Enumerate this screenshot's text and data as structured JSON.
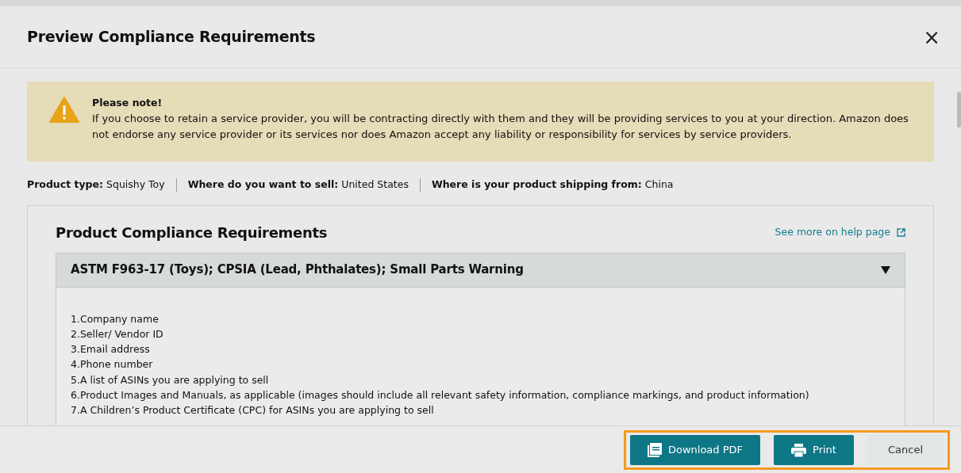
{
  "dialog": {
    "title": "Preview Compliance Requirements",
    "close": "×"
  },
  "notice": {
    "title": "Please note!",
    "text": "If you choose to retain a service provider, you will be contracting directly with them and they will be providing services to you at your direction. Amazon does not endorse any service provider or its services nor does Amazon accept any liability or responsibility for services by service providers."
  },
  "filters": [
    {
      "label": "Product type:",
      "value": "Squishy Toy"
    },
    {
      "label": "Where do you want to sell:",
      "value": "United States"
    },
    {
      "label": "Where is your product shipping from:",
      "value": "China"
    }
  ],
  "section": {
    "title": "Product Compliance Requirements",
    "help_link": "See more on help page",
    "accordion": {
      "title": "ASTM F963-17 (Toys); CPSIA (Lead, Phthalates); Small Parts Warning",
      "expanded": true,
      "items": [
        "1.Company name",
        "2.Seller/ Vendor ID",
        "3.Email address",
        "4.Phone number",
        "5.A list of ASINs you are applying to sell",
        "6.Product Images and Manuals, as applicable (images should include all relevant safety information, compliance markings, and product information)",
        "7.A Children’s Product Certificate (CPC) for ASINs you are applying to sell"
      ]
    }
  },
  "buttons": [
    {
      "kind": "pdf",
      "label": "Download PDF"
    },
    {
      "kind": "print",
      "label": "Print"
    },
    {
      "kind": "cancel",
      "label": "Cancel"
    }
  ]
}
